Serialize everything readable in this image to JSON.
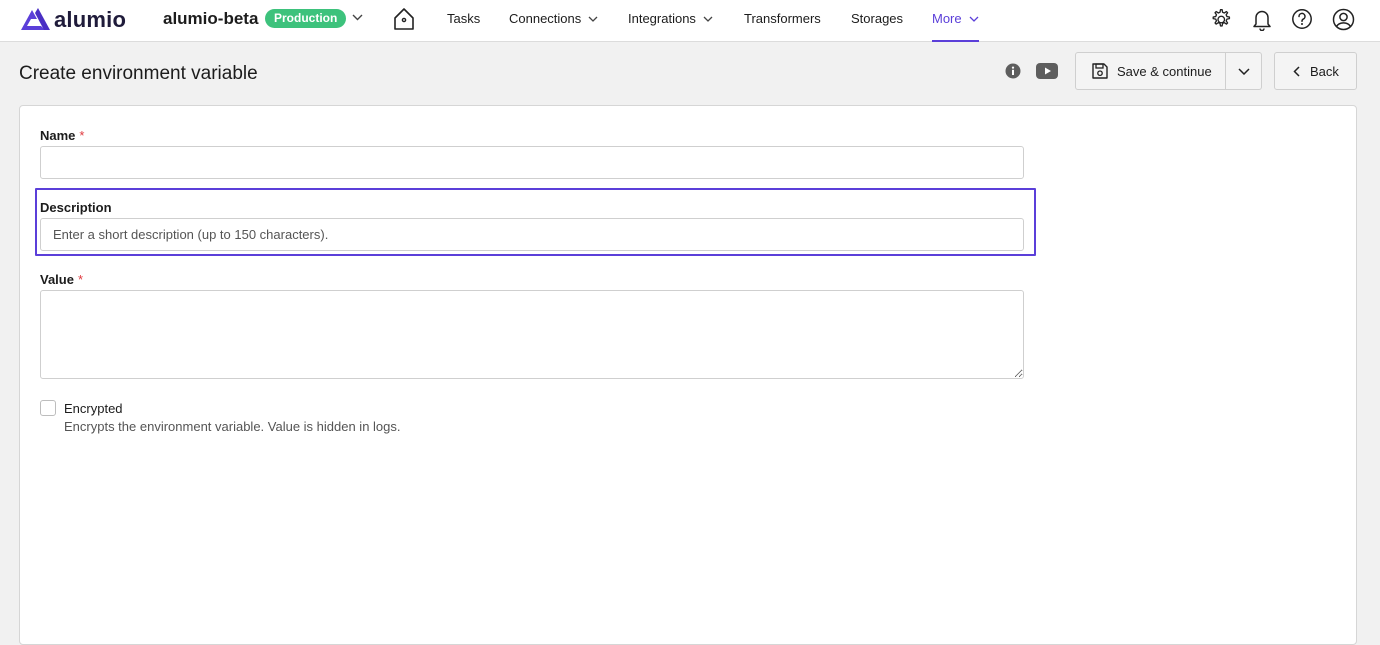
{
  "brand": {
    "name": "alumio",
    "accent": "#5b3fd9"
  },
  "environment": {
    "name": "alumio-beta",
    "badge": "Production",
    "badge_color": "#3dc27c"
  },
  "nav": {
    "items": [
      {
        "label": "Tasks",
        "has_dropdown": false,
        "active": false
      },
      {
        "label": "Connections",
        "has_dropdown": true,
        "active": false
      },
      {
        "label": "Integrations",
        "has_dropdown": true,
        "active": false
      },
      {
        "label": "Transformers",
        "has_dropdown": false,
        "active": false
      },
      {
        "label": "Storages",
        "has_dropdown": false,
        "active": false
      },
      {
        "label": "More",
        "has_dropdown": true,
        "active": true
      }
    ],
    "icons": [
      "home-icon",
      "gear-icon",
      "bell-icon",
      "help-icon",
      "user-icon"
    ]
  },
  "page": {
    "title": "Create environment variable",
    "save_label": "Save & continue",
    "back_label": "Back"
  },
  "form": {
    "name": {
      "label": "Name",
      "required": "*",
      "value": "",
      "placeholder": ""
    },
    "description": {
      "label": "Description",
      "value": "",
      "placeholder": "Enter a short description (up to 150 characters)."
    },
    "value": {
      "label": "Value",
      "required": "*",
      "value": ""
    },
    "encrypted": {
      "label": "Encrypted",
      "checked": false,
      "help": "Encrypts the environment variable. Value is hidden in logs."
    }
  }
}
